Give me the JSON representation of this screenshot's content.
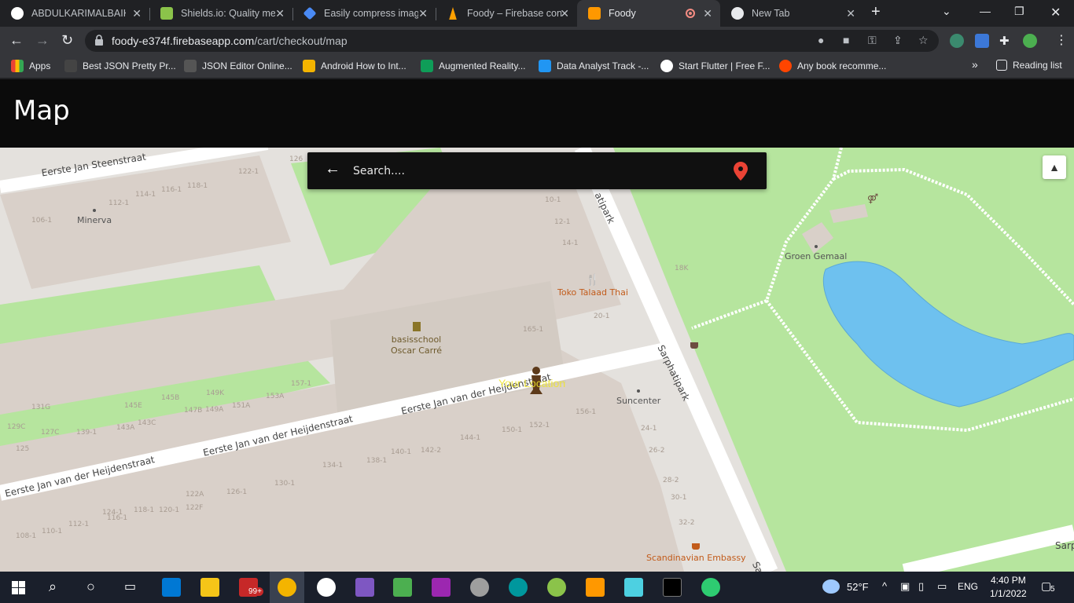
{
  "browser": {
    "tabs": [
      {
        "title": "ABDULKARIMALBAIK/",
        "favicon": "github-icon",
        "color": "#ffffff"
      },
      {
        "title": "Shields.io: Quality met",
        "favicon": "shields-icon",
        "color": "#8bc34a"
      },
      {
        "title": "Easily compress image",
        "favicon": "diamond-icon",
        "color": "#4a8af4"
      },
      {
        "title": "Foody – Firebase cons",
        "favicon": "firebase-icon",
        "color": "#ffa000"
      },
      {
        "title": "Foody",
        "favicon": "foody-icon",
        "color": "#ff9800"
      },
      {
        "title": "New Tab",
        "favicon": "chrome-icon",
        "color": "#e8eaed"
      }
    ],
    "url": {
      "host": "foody-e374f.firebaseapp.com",
      "path": "/cart/checkout/map"
    },
    "bookmarks": [
      {
        "label": "Apps",
        "color": "#ea4335"
      },
      {
        "label": "Best JSON Pretty Pr...",
        "color": "#444444"
      },
      {
        "label": "JSON Editor Online...",
        "color": "#555555"
      },
      {
        "label": "Android How to Int...",
        "color": "#f4b400"
      },
      {
        "label": "Augmented Reality...",
        "color": "#0f9d58"
      },
      {
        "label": "Data Analyst Track -...",
        "color": "#2196f3"
      },
      {
        "label": "Start Flutter | Free F...",
        "color": "#ffffff"
      },
      {
        "label": "Any book recomme...",
        "color": "#ff4500"
      }
    ],
    "more_bookmarks": "»",
    "reading_list": "Reading list"
  },
  "app": {
    "title": "Map",
    "search": {
      "placeholder": "Search...."
    },
    "map": {
      "streets": [
        "Eerste Jan Steenstraat",
        "Eerste Jan van der Heijdenstraat",
        "Eerste Jan van der Heijdenstraat",
        "Eerste Jan van der Heijdenstraat",
        "Sarphatipark",
        "atipark",
        "Sarp",
        "Sa"
      ],
      "places": [
        "Minerva",
        "Groen Gemaal",
        "Toko Talaad Thai",
        "basisschool",
        "Oscar Carré",
        "Suncenter",
        "Scandinavian Embassy"
      ],
      "house_numbers": [
        "122-1",
        "114-1",
        "116-1",
        "118-1",
        "112-1",
        "106-1",
        "10-1",
        "12-1",
        "14-1",
        "18K",
        "20-1",
        "165-1",
        "157-1",
        "153A",
        "149K",
        "147B",
        "149A",
        "151A",
        "145E",
        "145B",
        "143A",
        "143C",
        "139-1",
        "131G",
        "127C",
        "129C",
        "125",
        "156-1",
        "150-1",
        "152-1",
        "144-1",
        "142-2",
        "140-1",
        "138-1",
        "134-1",
        "130-1",
        "126-1",
        "122A",
        "122F",
        "124-1",
        "120-1",
        "118-1",
        "116-1",
        "112-1",
        "110-1",
        "108-1",
        "24-1",
        "26-2",
        "28-2",
        "30-1",
        "32-2",
        "126"
      ],
      "location_label": "Your Location",
      "colors": {
        "park": "#b6e59e",
        "water": "#6ec1ef",
        "road": "#ffffff",
        "building": "#d9d0c9"
      }
    }
  },
  "taskbar": {
    "weather": "52°F",
    "language": "ENG",
    "time": "4:40 PM",
    "date": "1/1/2022",
    "notifications": "5",
    "mail_badge": "99+"
  }
}
